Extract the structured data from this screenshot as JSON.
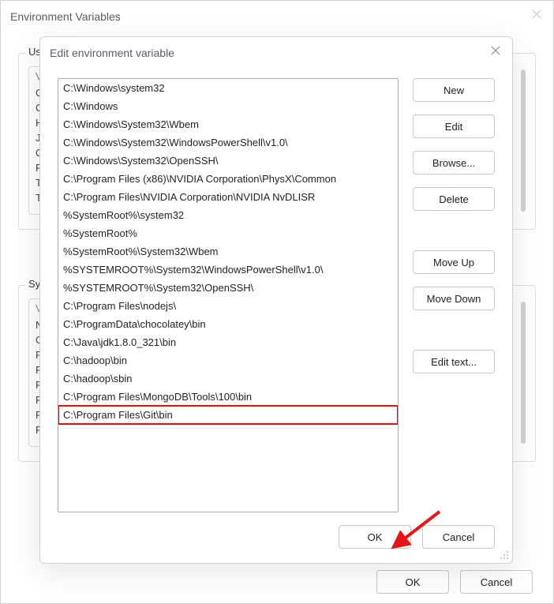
{
  "parentDialog": {
    "title": "Environment Variables",
    "user": {
      "label": "User",
      "header": "Va",
      "rows": [
        "Ch",
        "Ch",
        "HA",
        "JA",
        "On",
        "Pa",
        "TE",
        "TM"
      ]
    },
    "system": {
      "label": "Syste",
      "header": "Va",
      "rows": [
        "NU",
        "OS",
        "Pa",
        "PA",
        "PR",
        "PR",
        "PR",
        "PR"
      ]
    },
    "ok": "OK",
    "cancel": "Cancel"
  },
  "childDialog": {
    "title": "Edit environment variable",
    "paths": [
      "C:\\Windows\\system32",
      "C:\\Windows",
      "C:\\Windows\\System32\\Wbem",
      "C:\\Windows\\System32\\WindowsPowerShell\\v1.0\\",
      "C:\\Windows\\System32\\OpenSSH\\",
      "C:\\Program Files (x86)\\NVIDIA Corporation\\PhysX\\Common",
      "C:\\Program Files\\NVIDIA Corporation\\NVIDIA NvDLISR",
      "%SystemRoot%\\system32",
      "%SystemRoot%",
      "%SystemRoot%\\System32\\Wbem",
      "%SYSTEMROOT%\\System32\\WindowsPowerShell\\v1.0\\",
      "%SYSTEMROOT%\\System32\\OpenSSH\\",
      "C:\\Program Files\\nodejs\\",
      "C:\\ProgramData\\chocolatey\\bin",
      "C:\\Java\\jdk1.8.0_321\\bin",
      "C:\\hadoop\\bin",
      "C:\\hadoop\\sbin",
      "C:\\Program Files\\MongoDB\\Tools\\100\\bin",
      "C:\\Program Files\\Git\\bin"
    ],
    "highlightIndex": 18,
    "buttons": {
      "new": "New",
      "edit": "Edit",
      "browse": "Browse...",
      "delete": "Delete",
      "moveUp": "Move Up",
      "moveDown": "Move Down",
      "editText": "Edit text..."
    },
    "ok": "OK",
    "cancel": "Cancel"
  }
}
